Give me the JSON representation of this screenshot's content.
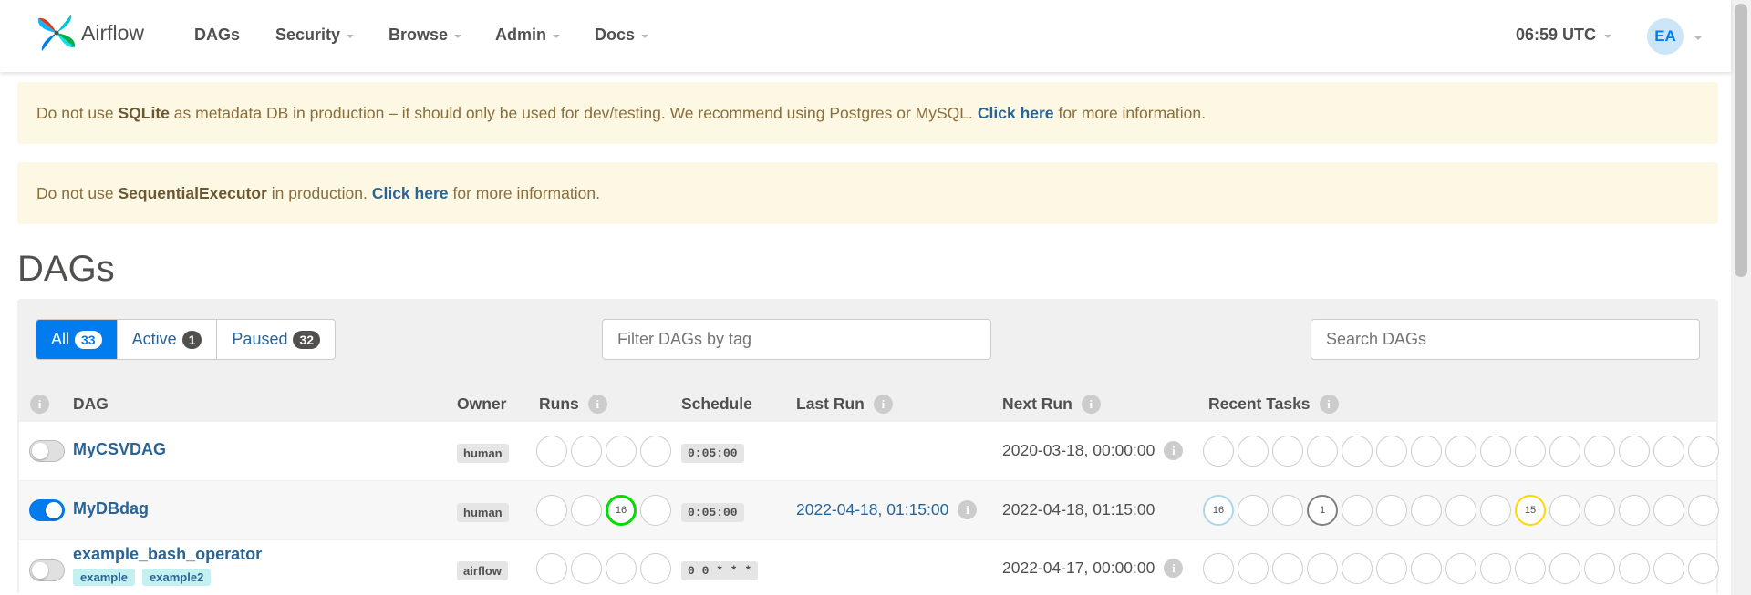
{
  "header": {
    "brand": "Airflow",
    "nav": [
      "DAGs",
      "Security",
      "Browse",
      "Admin",
      "Docs"
    ],
    "time": "06:59 UTC",
    "user_initials": "EA"
  },
  "alerts": [
    {
      "pre": "Do not use ",
      "bold": "SQLite",
      "mid": " as metadata DB in production – it should only be used for dev/testing. We recommend using Postgres or MySQL.",
      "link": "Click here",
      "post": "for more information."
    },
    {
      "pre": "Do not use ",
      "bold": "SequentialExecutor",
      "mid": " in production.",
      "link": "Click here",
      "post": "for more information."
    }
  ],
  "page_title": "DAGs",
  "filters": {
    "all_label": "All",
    "all_count": "33",
    "active_label": "Active",
    "active_count": "1",
    "paused_label": "Paused",
    "paused_count": "32",
    "tag_placeholder": "Filter DAGs by tag",
    "search_placeholder": "Search DAGs"
  },
  "columns": {
    "dag": "DAG",
    "owner": "Owner",
    "runs": "Runs",
    "schedule": "Schedule",
    "last_run": "Last Run",
    "next_run": "Next Run",
    "recent_tasks": "Recent Tasks",
    "info_glyph": "i"
  },
  "dags": [
    {
      "name": "MyCSVDAG",
      "enabled": false,
      "owner": "human",
      "runs": [
        "",
        "",
        "",
        ""
      ],
      "schedule": "0:05:00",
      "last_run": "",
      "next_run": "2020-03-18, 00:00:00",
      "tags": [],
      "recent_tasks": [
        "",
        "",
        "",
        "",
        "",
        "",
        "",
        "",
        "",
        "",
        "",
        "",
        "",
        "",
        "",
        ""
      ]
    },
    {
      "name": "MyDBdag",
      "enabled": true,
      "owner": "human",
      "runs": [
        "",
        "",
        "16",
        ""
      ],
      "schedule": "0:05:00",
      "last_run": "2022-04-18, 01:15:00",
      "next_run": "2022-04-18, 01:15:00",
      "tags": [],
      "recent_tasks": [
        "16",
        "",
        "",
        "1",
        "",
        "",
        "",
        "",
        "",
        "15",
        "",
        "",
        "",
        "",
        "",
        ""
      ]
    },
    {
      "name": "example_bash_operator",
      "enabled": false,
      "owner": "airflow",
      "runs": [
        "",
        "",
        "",
        ""
      ],
      "schedule": "0 0 * * *",
      "last_run": "",
      "next_run": "2022-04-17, 00:00:00",
      "tags": [
        "example",
        "example2"
      ],
      "recent_tasks": [
        "",
        "",
        "",
        "",
        "",
        "",
        "",
        "",
        "",
        "",
        "",
        "",
        "",
        "",
        "",
        ""
      ]
    }
  ],
  "colors": {
    "accent": "#017cee",
    "link": "#2a6496",
    "alert_bg": "#fcf8e3",
    "run_success": "#00dd00",
    "task_queued": "#add8e6",
    "task_upstream_failed": "#808080",
    "task_up_for_retry": "#ffd700"
  }
}
